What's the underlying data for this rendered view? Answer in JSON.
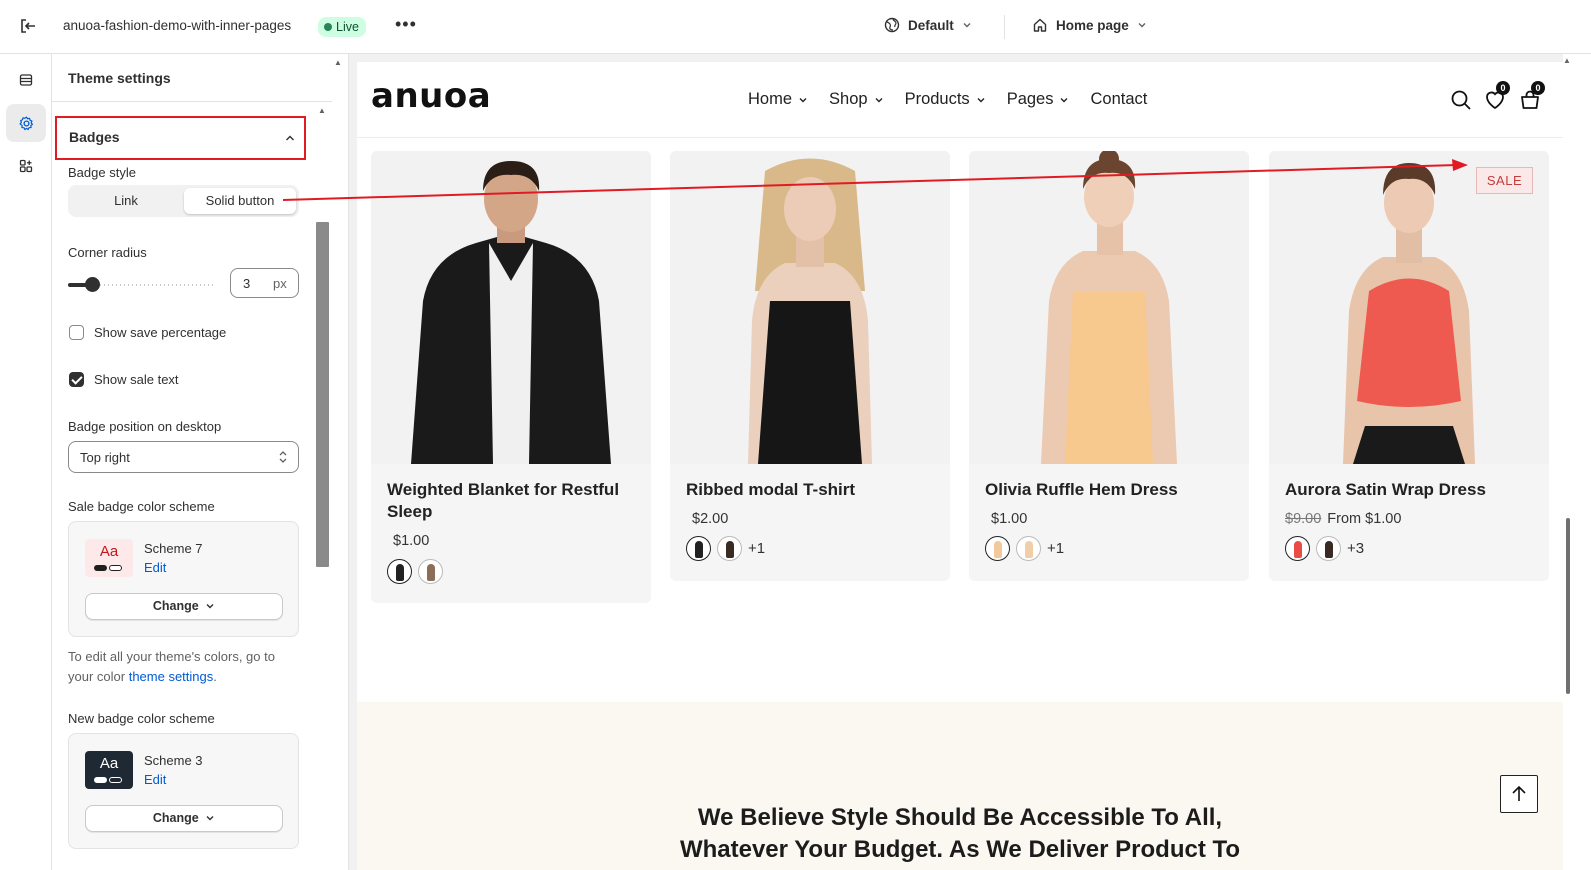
{
  "topbar": {
    "store_name": "anuoa-fashion-demo-with-inner-pages",
    "status": "Live",
    "more": "•••",
    "theme": "Default",
    "page": "Home page"
  },
  "rail": {
    "items": [
      "sections-icon",
      "gear-icon",
      "apps-icon"
    ]
  },
  "panel": {
    "title": "Theme settings",
    "section": "Badges",
    "badge_style_label": "Badge style",
    "badge_style_options": [
      "Link",
      "Solid button"
    ],
    "badge_style_selected": "Solid button",
    "corner_radius_label": "Corner radius",
    "corner_radius_value": "3",
    "corner_radius_unit": "px",
    "corner_radius_slider_fraction": 0.15,
    "show_save_percentage": {
      "label": "Show save percentage",
      "checked": false
    },
    "show_sale_text": {
      "label": "Show sale text",
      "checked": true
    },
    "badge_position_label": "Badge position on desktop",
    "badge_position_value": "Top right",
    "sale_scheme_label": "Sale badge color scheme",
    "sale_scheme": {
      "aa": "Aa",
      "name": "Scheme 7",
      "edit": "Edit",
      "change": "Change",
      "bg": "#fde8ea",
      "fg": "#c4161c"
    },
    "help_text_pre": "To edit all your theme's colors, go to your color ",
    "help_link": "theme settings",
    "help_text_post": ".",
    "new_scheme_label": "New badge color scheme",
    "new_scheme": {
      "aa": "Aa",
      "name": "Scheme 3",
      "edit": "Edit",
      "change": "Change",
      "bg": "#1f2933",
      "fg": "#ffffff"
    }
  },
  "site": {
    "logo": "anuoa",
    "nav": [
      "Home",
      "Shop",
      "Products",
      "Pages",
      "Contact"
    ],
    "nav_has_dropdown": [
      true,
      true,
      true,
      true,
      false
    ],
    "wishlist_count": "0",
    "cart_count": "0",
    "products": [
      {
        "title": "Weighted Blanket for Restful Sleep",
        "price": "$1.00",
        "compare": "",
        "swatches": 2,
        "more": ""
      },
      {
        "title": "Ribbed modal T-shirt",
        "price": "$2.00",
        "compare": "",
        "swatches": 2,
        "more": "+1"
      },
      {
        "title": "Olivia Ruffle Hem Dress",
        "price": "$1.00",
        "compare": "",
        "swatches": 2,
        "more": "+1"
      },
      {
        "title": "Aurora Satin Wrap Dress",
        "price": "From $1.00",
        "compare": "$9.00",
        "swatches": 2,
        "more": "+3",
        "badge": "SALE"
      }
    ],
    "banner_line1": "We Believe Style Should Be Accessible To All,",
    "banner_line2": "Whatever Your Budget. As We Deliver Product To"
  },
  "colors": {
    "annotation_red": "#e01b24",
    "live_bg": "#cdfee1",
    "live_fg": "#0c5132",
    "link_blue": "#005bd3"
  }
}
